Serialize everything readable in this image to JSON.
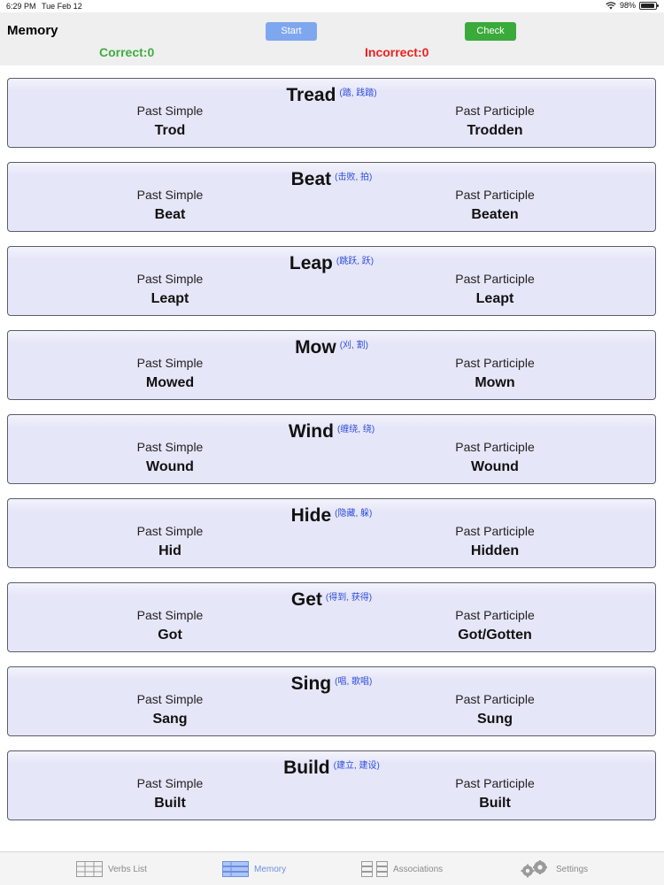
{
  "status": {
    "time": "6:29 PM",
    "date": "Tue Feb 12",
    "battery": "98%"
  },
  "header": {
    "title": "Memory",
    "start_label": "Start",
    "check_label": "Check",
    "correct": "Correct:0",
    "incorrect": "Incorrect:0"
  },
  "labels": {
    "past_simple": "Past Simple",
    "past_participle": "Past Participle"
  },
  "verbs": [
    {
      "verb": "Tread",
      "translation": "(踏, 践踏)",
      "past_simple": "Trod",
      "past_participle": "Trodden"
    },
    {
      "verb": "Beat",
      "translation": "(击败, 拍)",
      "past_simple": "Beat",
      "past_participle": "Beaten"
    },
    {
      "verb": "Leap",
      "translation": "(跳跃, 跃)",
      "past_simple": "Leapt",
      "past_participle": "Leapt"
    },
    {
      "verb": "Mow",
      "translation": "(刈, 割)",
      "past_simple": "Mowed",
      "past_participle": "Mown"
    },
    {
      "verb": "Wind",
      "translation": "(缠绕, 绕)",
      "past_simple": "Wound",
      "past_participle": "Wound"
    },
    {
      "verb": "Hide",
      "translation": "(隐藏, 躲)",
      "past_simple": "Hid",
      "past_participle": "Hidden"
    },
    {
      "verb": "Get",
      "translation": "(得到, 获得)",
      "past_simple": "Got",
      "past_participle": "Got/Gotten"
    },
    {
      "verb": "Sing",
      "translation": "(唱, 歌唱)",
      "past_simple": "Sang",
      "past_participle": "Sung"
    },
    {
      "verb": "Build",
      "translation": "(建立, 建设)",
      "past_simple": "Built",
      "past_participle": "Built"
    }
  ],
  "tabs": [
    {
      "label": "Verbs List",
      "icon": "list-icon",
      "active": false
    },
    {
      "label": "Memory",
      "icon": "memory-icon",
      "active": true
    },
    {
      "label": "Associations",
      "icon": "associations-icon",
      "active": false
    },
    {
      "label": "Settings",
      "icon": "gear-icon",
      "active": false
    }
  ]
}
